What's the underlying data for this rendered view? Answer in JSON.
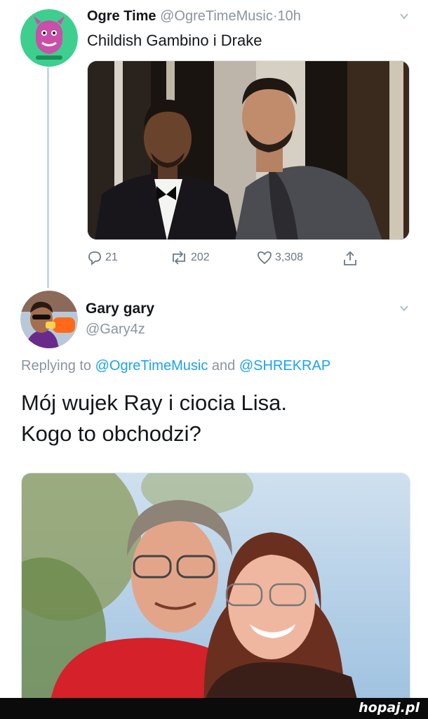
{
  "tweet1": {
    "display_name": "Ogre Time",
    "handle": "@OgreTimeMusic",
    "separator": "·",
    "time": "10h",
    "text": "Childish Gambino i Drake",
    "actions": {
      "replies": "21",
      "retweets": "202",
      "likes": "3,308"
    }
  },
  "reply": {
    "display_name": "Gary gary",
    "handle": "@Gary4z",
    "replying_prefix": "Replying to",
    "mention1": "@OgreTimeMusic",
    "connector": "and",
    "mention2": "@SHREKRAP",
    "text_line1": "Mój wujek Ray i ciocia Lisa.",
    "text_line2": "Kogo to obchodzi?"
  },
  "footer": {
    "brand": "hopaj.pl"
  },
  "colors": {
    "link": "#1da1f2",
    "secondary_text": "#8a95a0",
    "thread_line": "#ccd6dd"
  }
}
